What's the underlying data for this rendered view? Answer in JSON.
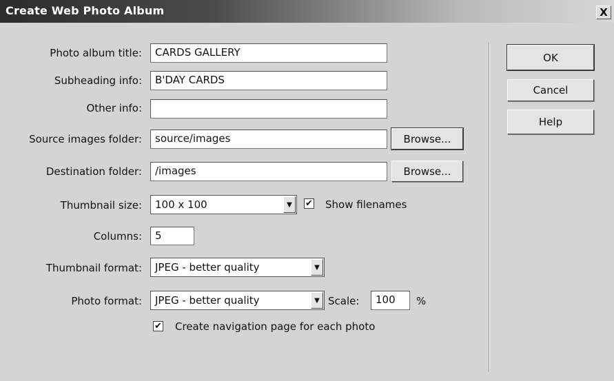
{
  "window": {
    "title": "Create Web Photo Album",
    "close_label": "X"
  },
  "fields": {
    "album_title": {
      "label": "Photo album title:",
      "value": "CARDS GALLERY"
    },
    "subheading": {
      "label": "Subheading info:",
      "value": "B'DAY CARDS"
    },
    "other_info": {
      "label": "Other info:",
      "value": ""
    },
    "source_folder": {
      "label": "Source images folder:",
      "value": "source/images",
      "browse": "Browse..."
    },
    "dest_folder": {
      "label": "Destination folder:",
      "value": "/images",
      "browse": "Browse..."
    },
    "thumb_size": {
      "label": "Thumbnail size:",
      "value": "100 x 100",
      "show_filenames_label": "Show filenames",
      "show_filenames_checked": true
    },
    "columns": {
      "label": "Columns:",
      "value": "5"
    },
    "thumb_format": {
      "label": "Thumbnail format:",
      "value": "JPEG - better quality"
    },
    "photo_format": {
      "label": "Photo format:",
      "value": "JPEG - better quality",
      "scale_label": "Scale:",
      "scale_value": "100",
      "scale_unit": "%"
    },
    "nav_page": {
      "label": "Create navigation page for each photo",
      "checked": true
    }
  },
  "buttons": {
    "ok": "OK",
    "cancel": "Cancel",
    "help": "Help"
  },
  "icons": {
    "dropdown": "▼",
    "check": "✔"
  }
}
